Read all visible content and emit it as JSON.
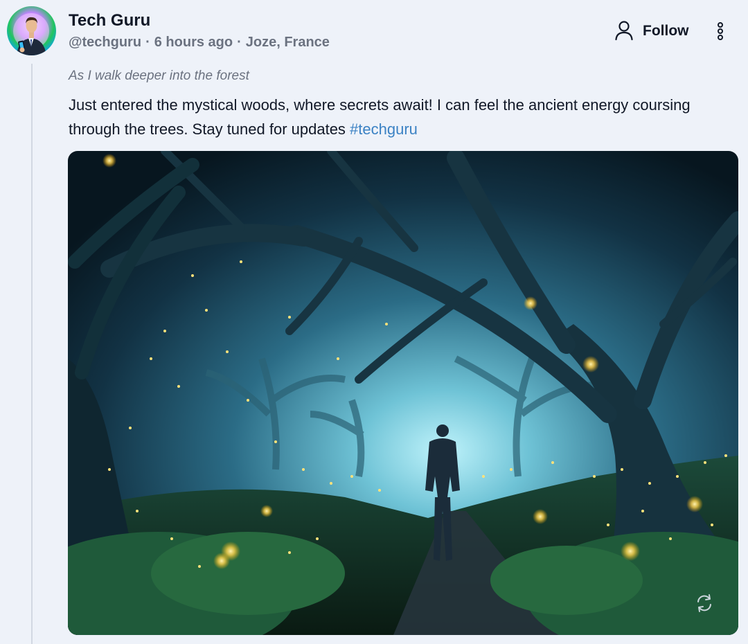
{
  "post": {
    "author_name": "Tech Guru",
    "handle": "@techguru",
    "separator": "·",
    "time_ago": "6 hours ago",
    "location": "Joze, France",
    "follow_label": "Follow",
    "subtitle": "As I walk deeper into the forest",
    "body_text": "Just entered the mystical woods, where secrets await! I can feel the ancient energy coursing through the trees. Stay tuned for updates ",
    "hashtag": "#techguru"
  },
  "icons": {
    "follow": "user-icon",
    "more": "more-vertical-icon",
    "media_overlay": "loop-icon"
  },
  "colors": {
    "background": "#eef2f9",
    "text_primary": "#111827",
    "text_secondary": "#6b7280",
    "hashtag": "#3b82c4",
    "thread_line": "#d2d8e2"
  }
}
